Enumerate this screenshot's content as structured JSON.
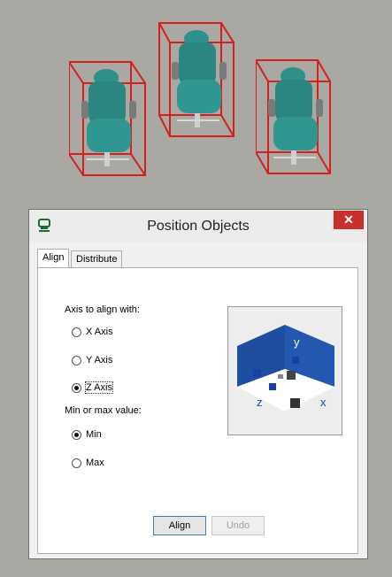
{
  "dialog": {
    "title": "Position Objects",
    "close_glyph": "✕",
    "tabs": [
      {
        "label": "Align"
      },
      {
        "label": "Distribute"
      }
    ]
  },
  "align_tab": {
    "axis_heading": "Axis to align with:",
    "axis_options": [
      {
        "label": "X Axis",
        "checked": false
      },
      {
        "label": "Y Axis",
        "checked": false
      },
      {
        "label": "Z Axis",
        "checked": true
      }
    ],
    "value_heading": "Min or max value:",
    "value_options": [
      {
        "label": "Min",
        "checked": true
      },
      {
        "label": "Max",
        "checked": false
      }
    ],
    "preview": {
      "x_label": "x",
      "y_label": "y",
      "z_label": "z"
    }
  },
  "buttons": {
    "align": "Align",
    "undo": "Undo"
  },
  "colors": {
    "bbox": "#d41f1f",
    "chair": "#2f8f8a",
    "close": "#c7302b",
    "preview_wall": "#1f4ea0"
  },
  "icons": {
    "app": "position-objects-icon",
    "close": "close-icon"
  }
}
